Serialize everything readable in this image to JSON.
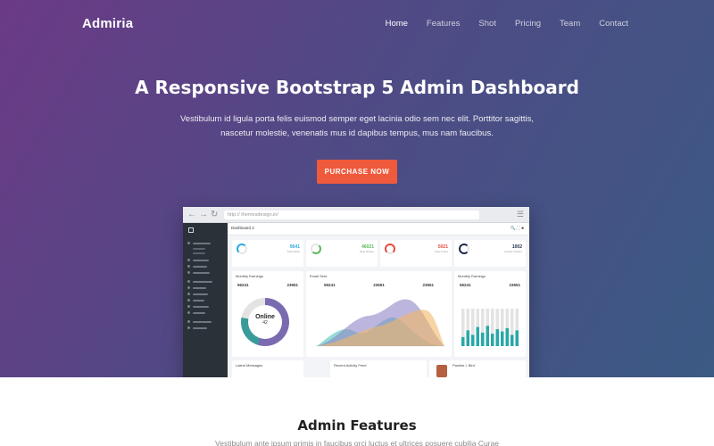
{
  "brand": "Admiria",
  "nav": [
    {
      "label": "Home",
      "active": true
    },
    {
      "label": "Features",
      "active": false
    },
    {
      "label": "Shot",
      "active": false
    },
    {
      "label": "Pricing",
      "active": false
    },
    {
      "label": "Team",
      "active": false
    },
    {
      "label": "Contact",
      "active": false
    }
  ],
  "hero": {
    "title": "A Responsive Bootstrap 5 Admin Dashboard",
    "subtitle": "Vestibulum id ligula porta felis euismod semper eget lacinia odio sem nec elit. Porttitor sagittis, nascetur molestie, venenatis mus id dapibus tempus, mus nam faucibus.",
    "cta_label": "PURCHASE NOW"
  },
  "preview": {
    "url": "http:// themesdesign.in/",
    "page_title": "Dashboard 2",
    "kpis": [
      {
        "value": "9541",
        "label": "Total Sales",
        "color": "#29a8e0"
      },
      {
        "value": "46021",
        "label": "New Orders",
        "color": "#5cb85c"
      },
      {
        "value": "5021",
        "label": "New Users",
        "color": "#e8493c"
      },
      {
        "value": "1002",
        "label": "Unique Visitors",
        "color": "#1d2b48"
      }
    ],
    "cards": {
      "earnings_title": "Monthly Earnings",
      "earnings_stats": [
        "56241",
        "23651"
      ],
      "donut_label": "Online",
      "donut_value": "42",
      "email_title": "Email Sent",
      "email_stats": [
        "56241",
        "23651",
        "23651"
      ],
      "earnings2_title": "Monthly Earnings",
      "earnings2_stats": [
        "56241",
        "23651"
      ],
      "messages_title": "Latest Messages",
      "activity_title": "Recent Activity Feed",
      "profile_name": "Pauline I. Bird"
    }
  },
  "features": {
    "title": "Admin Features",
    "subtitle": "Vestibulum ante ipsum primis in faucibus orci luctus et ultrices posuere cubilia Curae"
  },
  "colors": {
    "cta": "#ef5a3c",
    "hero_start": "#6b3a86",
    "hero_end": "#3b5a84",
    "sidebar": "#2b3138"
  }
}
